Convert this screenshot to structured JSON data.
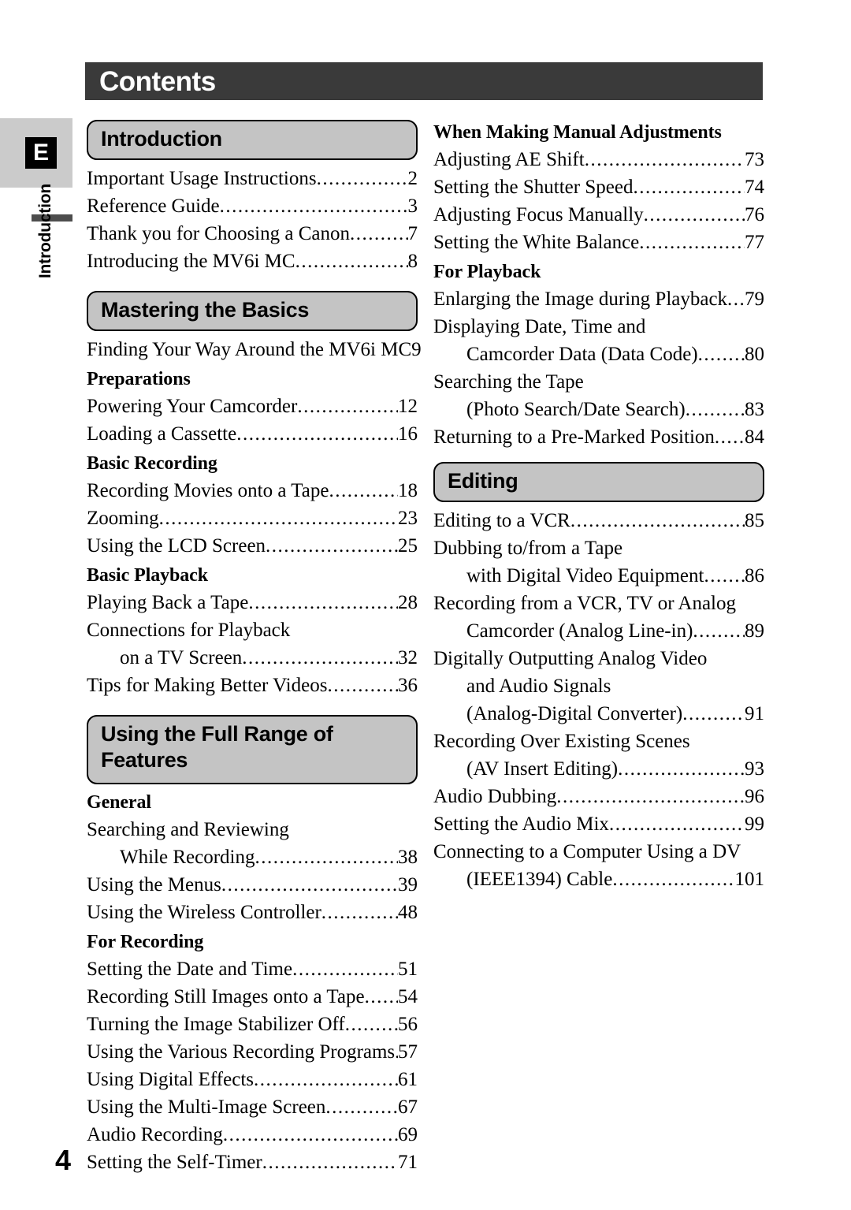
{
  "page": {
    "title": "Contents",
    "number": "4",
    "edge_tab": {
      "letter": "E",
      "vertical_label": "Introduction"
    }
  },
  "left_column": {
    "sections": [
      {
        "heading": "Introduction",
        "blocks": [
          {
            "type": "entries",
            "entries": [
              {
                "title": "Important Usage Instructions",
                "page": "2"
              },
              {
                "title": "Reference Guide",
                "page": "3"
              },
              {
                "title": "Thank you for Choosing a Canon",
                "page": "7"
              },
              {
                "title": "Introducing the MV6i MC",
                "page": "8"
              }
            ]
          }
        ]
      },
      {
        "heading": "Mastering the Basics",
        "blocks": [
          {
            "type": "entries",
            "entries": [
              {
                "title": "Finding Your Way Around the MV6i MC",
                "page": "9",
                "leader": "short"
              }
            ]
          },
          {
            "type": "subhead",
            "label": "Preparations"
          },
          {
            "type": "entries",
            "entries": [
              {
                "title": "Powering Your Camcorder",
                "page": "12"
              },
              {
                "title": "Loading a Cassette",
                "page": "16"
              }
            ]
          },
          {
            "type": "subhead",
            "label": "Basic Recording"
          },
          {
            "type": "entries",
            "entries": [
              {
                "title": "Recording Movies onto a Tape",
                "page": "18"
              },
              {
                "title": "Zooming",
                "page": "23"
              },
              {
                "title": "Using the LCD Screen",
                "page": "25"
              }
            ]
          },
          {
            "type": "subhead",
            "label": "Basic Playback"
          },
          {
            "type": "entries",
            "entries": [
              {
                "title": "Playing Back a Tape",
                "page": "28"
              },
              {
                "title": "Connections for Playback",
                "page": "",
                "noleader": true
              },
              {
                "title": "on a TV Screen",
                "page": "32",
                "indent": true
              },
              {
                "title": "Tips for Making Better Videos",
                "page": "36"
              }
            ]
          }
        ]
      },
      {
        "heading": "Using the Full Range of Features",
        "heading_line1": "Using the Full Range of",
        "heading_line2": "Features",
        "blocks": [
          {
            "type": "subhead",
            "label": "General"
          },
          {
            "type": "entries",
            "entries": [
              {
                "title": "Searching and Reviewing",
                "page": "",
                "noleader": true
              },
              {
                "title": "While Recording",
                "page": "38",
                "indent": true
              },
              {
                "title": "Using the Menus",
                "page": "39"
              },
              {
                "title": "Using the Wireless Controller",
                "page": "48"
              }
            ]
          },
          {
            "type": "subhead",
            "label": "For Recording"
          },
          {
            "type": "entries",
            "entries": [
              {
                "title": "Setting the Date and Time",
                "page": "51"
              },
              {
                "title": "Recording Still Images onto a Tape",
                "page": "54"
              },
              {
                "title": "Turning the Image Stabilizer Off",
                "page": "56"
              },
              {
                "title": "Using the Various Recording Programs",
                "page": "57"
              },
              {
                "title": "Using Digital Effects",
                "page": "61"
              },
              {
                "title": "Using the Multi-Image Screen",
                "page": "67"
              },
              {
                "title": "Audio Recording",
                "page": "69"
              },
              {
                "title": "Setting the Self-Timer",
                "page": "71"
              }
            ]
          }
        ]
      }
    ]
  },
  "right_column": {
    "blocks": [
      {
        "type": "subhead",
        "label": "When Making Manual Adjustments"
      },
      {
        "type": "entries",
        "entries": [
          {
            "title": "Adjusting AE Shift",
            "page": "73"
          },
          {
            "title": "Setting the Shutter Speed",
            "page": "74"
          },
          {
            "title": "Adjusting Focus Manually",
            "page": "76"
          },
          {
            "title": "Setting the White Balance",
            "page": "77"
          }
        ]
      },
      {
        "type": "subhead",
        "label": "For Playback"
      },
      {
        "type": "entries",
        "entries": [
          {
            "title": "Enlarging the Image during Playback",
            "page": "79"
          },
          {
            "title": "Displaying Date, Time and",
            "page": "",
            "noleader": true
          },
          {
            "title": "Camcorder Data (Data Code)",
            "page": "80",
            "indent": true
          },
          {
            "title": "Searching the Tape",
            "page": "",
            "noleader": true
          },
          {
            "title": "(Photo Search/Date Search)",
            "page": "83",
            "indent": true
          },
          {
            "title": "Returning to a Pre-Marked Position",
            "page": "84"
          }
        ]
      },
      {
        "type": "section",
        "heading": "Editing"
      },
      {
        "type": "entries",
        "entries": [
          {
            "title": "Editing to a VCR",
            "page": "85"
          },
          {
            "title": "Dubbing to/from a Tape",
            "page": "",
            "noleader": true
          },
          {
            "title": "with Digital Video Equipment",
            "page": "86",
            "indent": true
          },
          {
            "title": "Recording from a VCR, TV or Analog",
            "page": "",
            "noleader": true
          },
          {
            "title": "Camcorder (Analog Line-in)",
            "page": "89",
            "indent": true
          },
          {
            "title": "Digitally Outputting Analog Video",
            "page": "",
            "noleader": true
          },
          {
            "title": "and Audio Signals",
            "page": "",
            "indent": true,
            "noleader": true
          },
          {
            "title": "(Analog-Digital Converter)",
            "page": "91",
            "indent": true
          },
          {
            "title": "Recording Over Existing Scenes",
            "page": "",
            "noleader": true
          },
          {
            "title": "(AV Insert Editing)",
            "page": "93",
            "indent": true
          },
          {
            "title": "Audio Dubbing",
            "page": "96"
          },
          {
            "title": "Setting the Audio Mix",
            "page": "99"
          },
          {
            "title": "Connecting to a Computer Using a DV",
            "page": "",
            "noleader": true
          },
          {
            "title": "(IEEE1394) Cable",
            "page": "101",
            "indent": true
          }
        ]
      }
    ]
  }
}
